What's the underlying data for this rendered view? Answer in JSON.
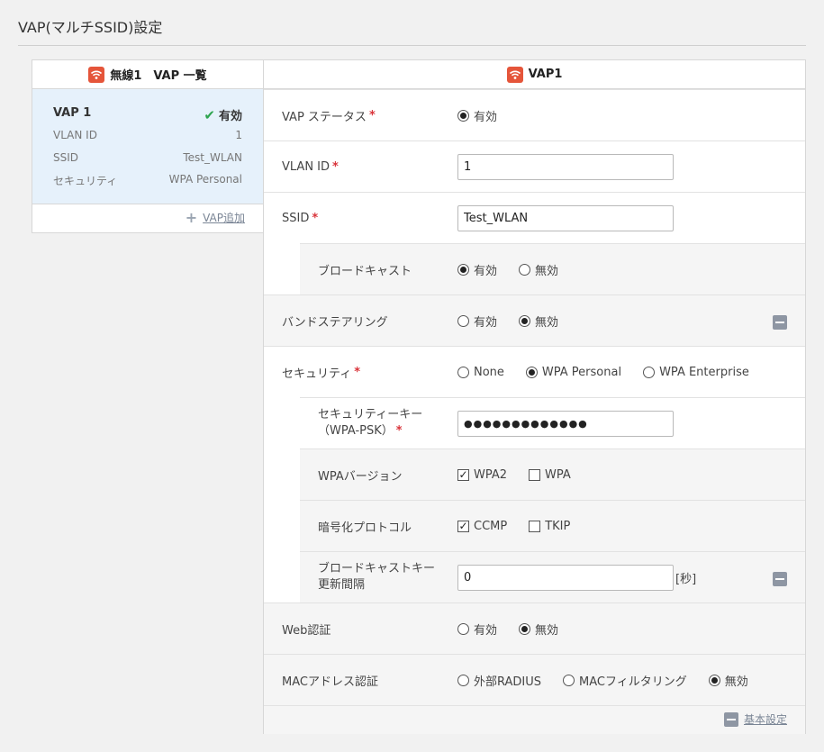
{
  "page": {
    "title": "VAP(マルチSSID)設定"
  },
  "left": {
    "header": "無線1　VAP 一覧",
    "vap": {
      "name": "VAP 1",
      "status": "有効",
      "fields": [
        {
          "label": "VLAN ID",
          "value": "1"
        },
        {
          "label": "SSID",
          "value": "Test_WLAN"
        },
        {
          "label": "セキュリティ",
          "value": "WPA Personal"
        }
      ]
    },
    "add_label": "VAP追加"
  },
  "right": {
    "header": "VAP1",
    "vap_status": {
      "label": "VAP ステータス",
      "options": [
        "有効"
      ]
    },
    "vlan_id": {
      "label": "VLAN ID",
      "value": "1"
    },
    "ssid": {
      "label": "SSID",
      "value": "Test_WLAN"
    },
    "broadcast": {
      "label": "ブロードキャスト",
      "options": [
        "有効",
        "無効"
      ],
      "selected": "有効"
    },
    "band_steering": {
      "label": "バンドステアリング",
      "options": [
        "有効",
        "無効"
      ],
      "selected": "無効"
    },
    "security": {
      "label": "セキュリティ",
      "options": [
        "None",
        "WPA Personal",
        "WPA Enterprise"
      ],
      "selected": "WPA Personal"
    },
    "security_key": {
      "label_line1": "セキュリティーキー",
      "label_line2": "（WPA-PSK）",
      "value": "●●●●●●●●●●●●●"
    },
    "wpa_version": {
      "label": "WPAバージョン",
      "options": [
        "WPA2",
        "WPA"
      ],
      "checked": [
        "WPA2"
      ]
    },
    "cipher": {
      "label": "暗号化プロトコル",
      "options": [
        "CCMP",
        "TKIP"
      ],
      "checked": [
        "CCMP"
      ]
    },
    "broadcast_key": {
      "label_line1": "ブロードキャストキー",
      "label_line2": "更新間隔",
      "value": "0",
      "unit": "[秒]"
    },
    "web_auth": {
      "label": "Web認証",
      "options": [
        "有効",
        "無効"
      ],
      "selected": "無効"
    },
    "mac_auth": {
      "label": "MACアドレス認証",
      "options": [
        "外部RADIUS",
        "MACフィルタリング",
        "無効"
      ],
      "selected": "無効"
    },
    "footer_link": "基本設定"
  },
  "colors": {
    "accent_red": "#e5553a",
    "required": "#d9333a",
    "selected_bg": "#e6f1fb",
    "check_green": "#2ea44f"
  }
}
